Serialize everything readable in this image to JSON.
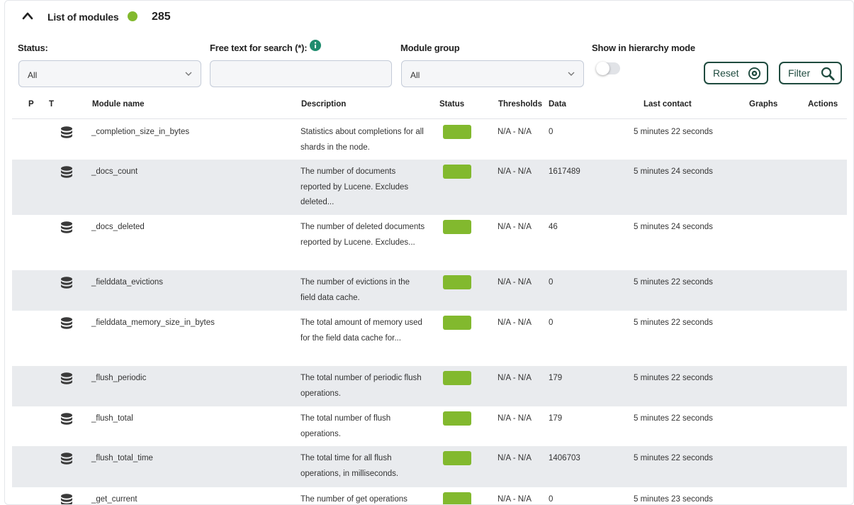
{
  "header": {
    "title": "List of modules",
    "count": "285",
    "status_color": "#82b92e"
  },
  "filters": {
    "status_label": "Status:",
    "status_value": "All",
    "search_label": "Free text for search (*):",
    "search_value": "",
    "group_label": "Module group",
    "group_value": "All",
    "hierarchy_label": "Show in hierarchy mode",
    "reset_label": "Reset",
    "filter_label": "Filter"
  },
  "table": {
    "columns": [
      "P",
      "T",
      "Module name",
      "Description",
      "Status",
      "Thresholds",
      "Data",
      "Last contact",
      "Graphs",
      "Actions"
    ],
    "rows": [
      {
        "name": "_completion_size_in_bytes",
        "desc": "Statistics about completions for all shards in the node.",
        "status": "ok",
        "thresholds": "N/A - N/A",
        "data": "0",
        "last_contact": "5 minutes 22 seconds"
      },
      {
        "name": "_docs_count",
        "desc": "The number of documents reported by Lucene. Excludes deleted...",
        "status": "ok",
        "thresholds": "N/A - N/A",
        "data": "1617489",
        "last_contact": "5 minutes 24 seconds"
      },
      {
        "name": "_docs_deleted",
        "desc": "The number of deleted documents reported by Lucene. Excludes...",
        "status": "ok",
        "thresholds": "N/A - N/A",
        "data": "46",
        "last_contact": "5 minutes 24 seconds"
      },
      {
        "name": "_fielddata_evictions",
        "desc": "The number of evictions in the field data cache.",
        "status": "ok",
        "thresholds": "N/A - N/A",
        "data": "0",
        "last_contact": "5 minutes 22 seconds"
      },
      {
        "name": "_fielddata_memory_size_in_bytes",
        "desc": "The total amount of memory used for the field data cache for...",
        "status": "ok",
        "thresholds": "N/A - N/A",
        "data": "0",
        "last_contact": "5 minutes 22 seconds"
      },
      {
        "name": "_flush_periodic",
        "desc": "The total number of periodic flush operations.",
        "status": "ok",
        "thresholds": "N/A - N/A",
        "data": "179",
        "last_contact": "5 minutes 22 seconds"
      },
      {
        "name": "_flush_total",
        "desc": "The total number of flush operations.",
        "status": "ok",
        "thresholds": "N/A - N/A",
        "data": "179",
        "last_contact": "5 minutes 22 seconds"
      },
      {
        "name": "_flush_total_time",
        "desc": "The total time for all flush operations, in milliseconds.",
        "status": "ok",
        "thresholds": "N/A - N/A",
        "data": "1406703",
        "last_contact": "5 minutes 22 seconds"
      },
      {
        "name": "_get_current",
        "desc": "The number of get operations",
        "status": "ok",
        "thresholds": "N/A - N/A",
        "data": "0",
        "last_contact": "5 minutes 23 seconds"
      }
    ]
  }
}
